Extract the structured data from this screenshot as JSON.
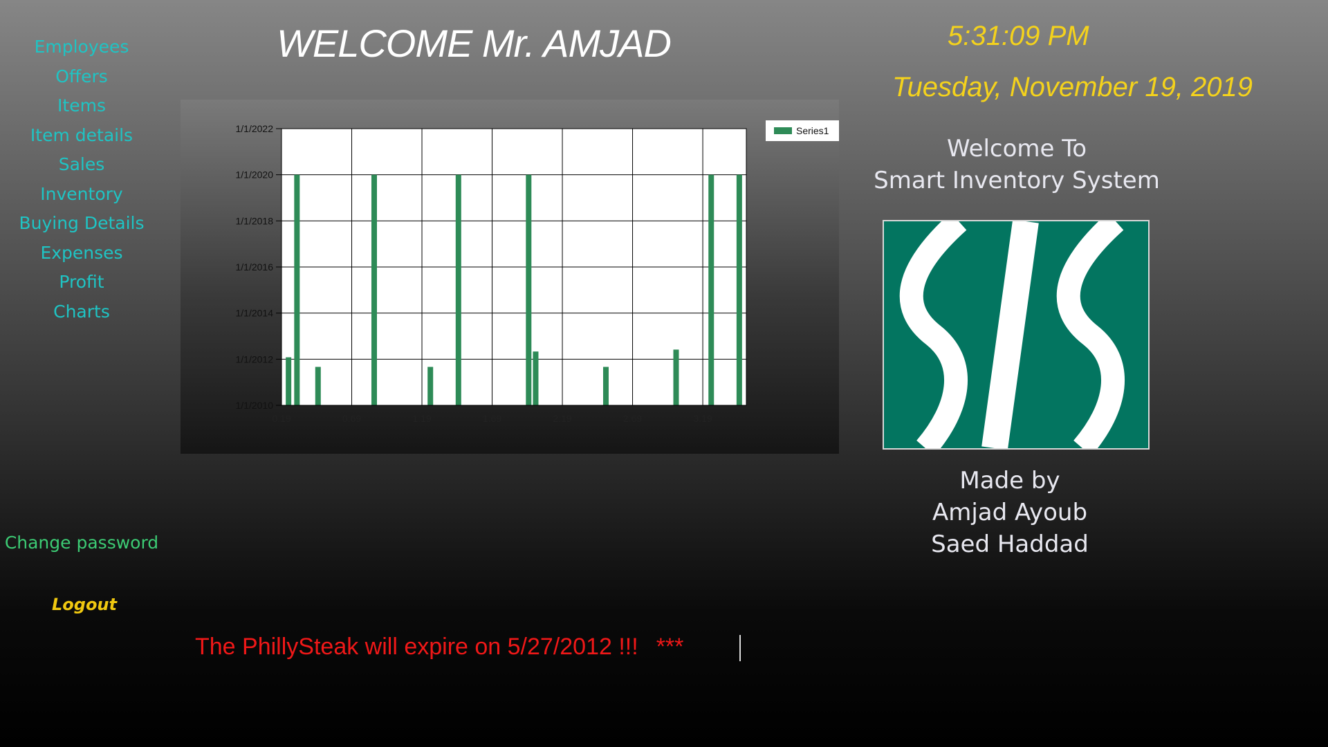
{
  "nav": {
    "items": [
      {
        "label": "Employees"
      },
      {
        "label": "Offers"
      },
      {
        "label": "Items"
      },
      {
        "label": "Item details"
      },
      {
        "label": "Sales"
      },
      {
        "label": "Inventory"
      },
      {
        "label": "Buying Details"
      },
      {
        "label": "Expenses"
      },
      {
        "label": "Profit"
      },
      {
        "label": "Charts"
      }
    ],
    "change_password": "Change password",
    "logout": "Logout"
  },
  "header": {
    "welcome": "WELCOME Mr. AMJAD",
    "time": "5:31:09 PM",
    "date": "Tuesday, November 19, 2019"
  },
  "info": {
    "welcome_line1": "Welcome To",
    "welcome_line2": "Smart Inventory System",
    "made_by_line1": "Made by",
    "made_by_line2": "Amjad Ayoub",
    "made_by_line3": "Saed Haddad",
    "logo_icon": "sis-logo-icon"
  },
  "ticker": {
    "message": "The PhillySteak will expire on 5/27/2012 !!!",
    "stars": "***"
  },
  "colors": {
    "nav": "#1fc4c4",
    "clock": "#f4d21c",
    "bars": "#2e8b57",
    "logo_bg": "#037560",
    "ticker": "#f01818"
  },
  "chart_data": {
    "type": "bar",
    "title": "",
    "xlabel": "",
    "ylabel": "",
    "xlim": [
      0.19,
      3.5
    ],
    "x_ticks": [
      "0.19",
      "0.69",
      "1.19",
      "1.69",
      "2.19",
      "2.69",
      "3.19"
    ],
    "ylim": [
      2010,
      2022
    ],
    "y_ticks": [
      "1/1/2010",
      "1/1/2012",
      "1/1/2014",
      "1/1/2016",
      "1/1/2018",
      "1/1/2020",
      "1/1/2022"
    ],
    "grid": true,
    "legend": "top-right",
    "series": [
      {
        "name": "Series1",
        "color": "#2e8b57",
        "points": [
          {
            "x": 0.24,
            "y": "2/2012"
          },
          {
            "x": 0.3,
            "y": "1/2020"
          },
          {
            "x": 0.45,
            "y": "9/2011"
          },
          {
            "x": 0.85,
            "y": "1/2020"
          },
          {
            "x": 1.25,
            "y": "9/2011"
          },
          {
            "x": 1.45,
            "y": "1/2020"
          },
          {
            "x": 1.95,
            "y": "1/2020"
          },
          {
            "x": 2.0,
            "y": "5/2012"
          },
          {
            "x": 2.5,
            "y": "9/2011"
          },
          {
            "x": 3.0,
            "y": "6/2012"
          },
          {
            "x": 3.25,
            "y": "1/2020"
          },
          {
            "x": 3.45,
            "y": "1/2020"
          }
        ]
      }
    ]
  }
}
